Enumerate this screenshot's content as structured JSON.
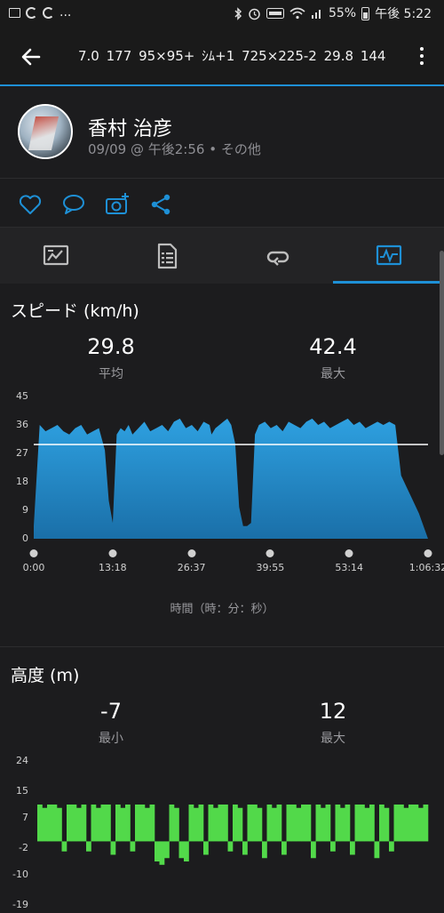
{
  "status_bar": {
    "left_text": "...",
    "battery": "55%",
    "time": "午後 5:22"
  },
  "app_bar": {
    "stats": [
      "7.0",
      "177",
      "95×95+",
      "ｼﾑ+1",
      "725×225-2",
      "29.8",
      "144"
    ]
  },
  "profile": {
    "name": "香村 治彦",
    "meta": "09/09 @ 午後2:56 • その他"
  },
  "actions": [
    "heart-icon",
    "comment-icon",
    "camera-add-icon",
    "share-icon"
  ],
  "tabs": [
    "overview-tab",
    "details-tab",
    "laps-tab",
    "charts-tab"
  ],
  "speed": {
    "title": "スピード (km/h)",
    "avg_value": "29.8",
    "avg_label": "平均",
    "max_value": "42.4",
    "max_label": "最大",
    "x_title": "時間（時：分：秒）"
  },
  "elevation": {
    "title": "高度 (m)",
    "min_value": "-7",
    "min_label": "最小",
    "max_value": "12",
    "max_label": "最大"
  },
  "colors": {
    "accent": "#1e90d6",
    "speed_fill": "#2ea0e0",
    "elevation_fill": "#52d94a"
  },
  "chart_data": [
    {
      "type": "area",
      "ylim": [
        0,
        45
      ],
      "ytick_labels": [
        "45",
        "36",
        "27",
        "18",
        "9",
        "0"
      ],
      "yticks": [
        45,
        36,
        27,
        18,
        9,
        0
      ],
      "xtick_labels": [
        "0:00",
        "13:18",
        "26:37",
        "39:55",
        "53:14",
        "1:06:32"
      ],
      "xlim": [
        0,
        3992
      ],
      "average_line": 29.8,
      "series": [
        {
          "x": [
            0,
            60,
            120,
            180,
            240,
            300,
            360,
            420,
            480,
            540,
            600,
            660,
            720,
            760,
            800,
            840,
            880,
            920,
            960,
            1000,
            1060,
            1120,
            1180,
            1240,
            1300,
            1360,
            1420,
            1480,
            1540,
            1600,
            1660,
            1720,
            1780,
            1800,
            1840,
            1880,
            1920,
            1960,
            2000,
            2040,
            2080,
            2120,
            2160,
            2200,
            2240,
            2280,
            2340,
            2400,
            2460,
            2520,
            2580,
            2640,
            2700,
            2760,
            2820,
            2880,
            2940,
            3000,
            3060,
            3120,
            3180,
            3240,
            3300,
            3360,
            3420,
            3480,
            3540,
            3600,
            3660,
            3720,
            3780,
            3840,
            3900,
            3992
          ],
          "values": [
            4,
            36,
            34,
            35,
            36,
            34,
            33,
            35,
            36,
            33,
            34,
            35,
            28,
            12,
            5,
            33,
            35,
            34,
            36,
            33,
            35,
            37,
            34,
            35,
            36,
            34,
            37,
            38,
            35,
            36,
            34,
            37,
            36,
            33,
            35,
            36,
            37,
            38,
            36,
            30,
            10,
            4,
            4,
            5,
            33,
            36,
            37,
            35,
            36,
            34,
            37,
            36,
            35,
            37,
            38,
            36,
            37,
            35,
            36,
            37,
            38,
            36,
            37,
            35,
            36,
            37,
            36,
            37,
            36,
            20,
            16,
            12,
            8,
            0
          ]
        }
      ]
    },
    {
      "type": "bar",
      "ylim": [
        -19,
        24
      ],
      "ytick_labels": [
        "24",
        "15",
        "7",
        "-2",
        "-10",
        "-19"
      ],
      "yticks": [
        24,
        15,
        7,
        -2,
        -10,
        -19
      ],
      "series": [
        {
          "values": [
            11,
            10,
            11,
            11,
            10,
            -3,
            11,
            11,
            10,
            11,
            -3,
            11,
            10,
            11,
            11,
            -4,
            11,
            10,
            11,
            -3,
            11,
            11,
            10,
            11,
            -6,
            -7,
            -5,
            11,
            10,
            -5,
            -6,
            11,
            10,
            11,
            -4,
            11,
            10,
            11,
            11,
            -3,
            11,
            10,
            -4,
            11,
            11,
            10,
            -5,
            11,
            10,
            11,
            -4,
            11,
            11,
            10,
            11,
            11,
            -5,
            11,
            10,
            11,
            -3,
            11,
            10,
            11,
            -4,
            11,
            11,
            10,
            11,
            -5,
            11,
            10,
            -3,
            11,
            11,
            10,
            11,
            11,
            10,
            11
          ]
        }
      ]
    }
  ]
}
